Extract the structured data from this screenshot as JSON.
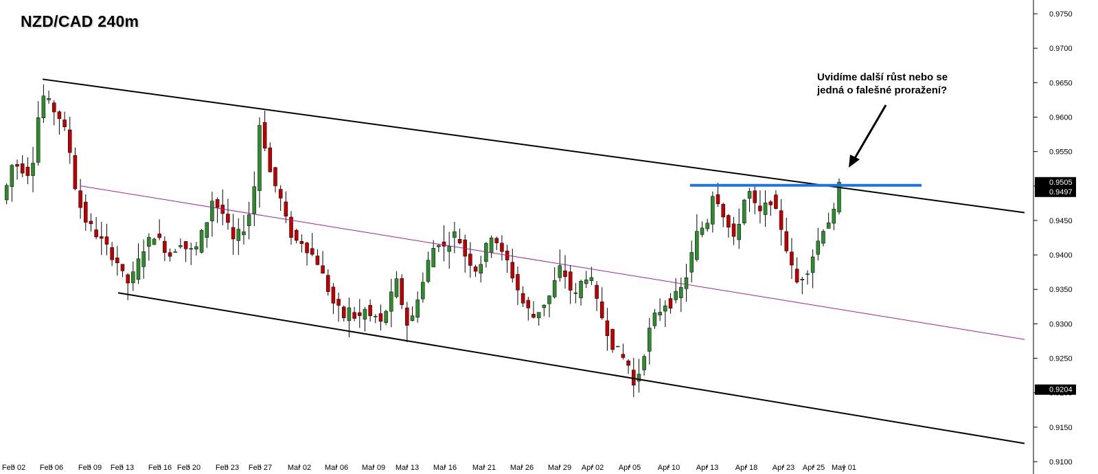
{
  "chart_data": {
    "type": "candlestick",
    "title": "NZD/CAD 240m",
    "annotation_lines": [
      "Uvidíme další růst nebo se",
      "jedná o falešné proražení?"
    ],
    "x_ticks": [
      "Feb 02",
      "Feb 06",
      "Feb 09",
      "Feb 13",
      "Feb 16",
      "Feb 20",
      "Feb 23",
      "Feb 27",
      "Mar 02",
      "Mar 06",
      "Mar 09",
      "Mar 13",
      "Mar 16",
      "Mar 21",
      "Mar 26",
      "Mar 29",
      "Apr 02",
      "Apr 05",
      "Apr 10",
      "Apr 13",
      "Apr 18",
      "Apr 23",
      "Apr 25",
      "May 01"
    ],
    "y_ticks": [
      "0.9750",
      "0.9700",
      "0.9650",
      "0.9600",
      "0.9550",
      "0.9500",
      "0.9450",
      "0.9400",
      "0.9350",
      "0.9300",
      "0.9250",
      "0.9200",
      "0.9150",
      "0.9100"
    ],
    "ylim": [
      0.91,
      0.976
    ],
    "price_labels": [
      "0.9505",
      "0.9497",
      "0.9204"
    ],
    "price_path": [
      0.948,
      0.95,
      0.953,
      0.953,
      0.9525,
      0.952,
      0.954,
      0.96,
      0.963,
      0.962,
      0.961,
      0.96,
      0.958,
      0.955,
      0.95,
      0.947,
      0.945,
      0.944,
      0.943,
      0.942,
      0.941,
      0.94,
      0.939,
      0.937,
      0.936,
      0.937,
      0.939,
      0.941,
      0.942,
      0.943,
      0.942,
      0.941,
      0.94,
      0.941,
      0.942,
      0.941,
      0.9405,
      0.941,
      0.943,
      0.945,
      0.948,
      0.947,
      0.946,
      0.944,
      0.942,
      0.943,
      0.944,
      0.946,
      0.95,
      0.959,
      0.956,
      0.952,
      0.95,
      0.948,
      0.945,
      0.943,
      0.942,
      0.942,
      0.941,
      0.94,
      0.939,
      0.937,
      0.935,
      0.933,
      0.932,
      0.931,
      0.932,
      0.931,
      0.931,
      0.932,
      0.931,
      0.931,
      0.93,
      0.932,
      0.934,
      0.936,
      0.933,
      0.93,
      0.931,
      0.934,
      0.936,
      0.939,
      0.941,
      0.942,
      0.941,
      0.942,
      0.943,
      0.942,
      0.94,
      0.939,
      0.938,
      0.939,
      0.941,
      0.943,
      0.942,
      0.94,
      0.939,
      0.937,
      0.935,
      0.933,
      0.932,
      0.931,
      0.932,
      0.933,
      0.934,
      0.936,
      0.938,
      0.937,
      0.935,
      0.934,
      0.936,
      0.937,
      0.936,
      0.933,
      0.931,
      0.929,
      0.927,
      0.926,
      0.925,
      0.924,
      0.921,
      0.923,
      0.926,
      0.929,
      0.931,
      0.932,
      0.933,
      0.933,
      0.934,
      0.935,
      0.937,
      0.94,
      0.943,
      0.944,
      0.945,
      0.949,
      0.948,
      0.946,
      0.944,
      0.942,
      0.945,
      0.948,
      0.949,
      0.947,
      0.946,
      0.947,
      0.948,
      0.946,
      0.944,
      0.941,
      0.938,
      0.936,
      0.937,
      0.938,
      0.94,
      0.942,
      0.944,
      0.945,
      0.946,
      0.95
    ],
    "series": [
      {
        "name": "upper-channel",
        "x": [
          "Feb 06",
          "May 01"
        ],
        "y": [
          0.9655,
          0.9497
        ]
      },
      {
        "name": "lower-channel",
        "x": [
          "Feb 13",
          "May 01"
        ],
        "y": [
          0.9345,
          0.917
        ]
      },
      {
        "name": "midline",
        "x": [
          "Feb 09",
          "May 01"
        ],
        "y": [
          0.95,
          0.932
        ]
      },
      {
        "name": "resistance-level",
        "x": [
          "Apr 13",
          "May 01"
        ],
        "y": [
          0.9501,
          0.9501
        ]
      }
    ],
    "colors": {
      "bull": "#2e8b2e",
      "bear": "#c00000",
      "resistance": "#1a73e8",
      "midline": "#a020a0",
      "channel": "#000000"
    },
    "grid": false,
    "legend": "none"
  }
}
